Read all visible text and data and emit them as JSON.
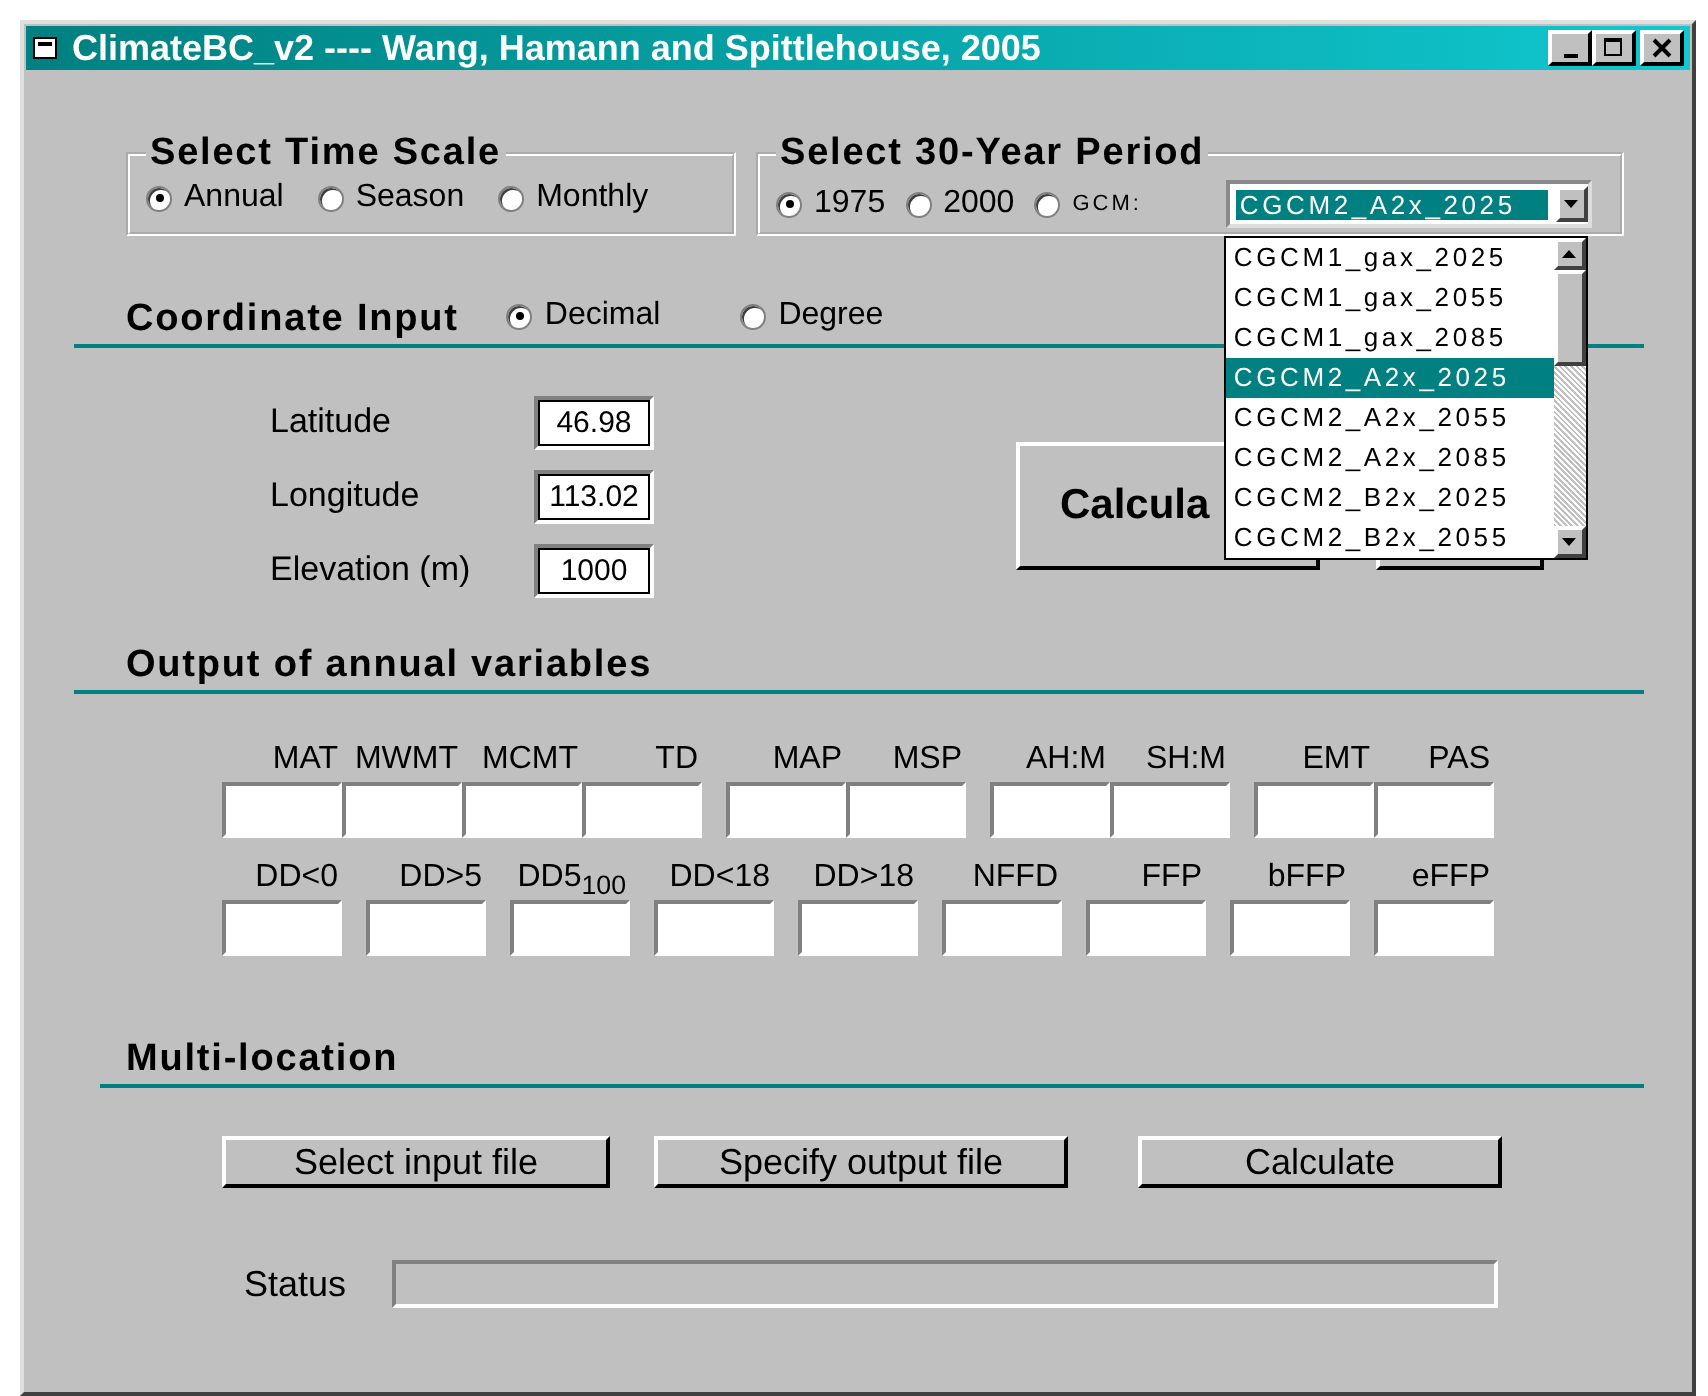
{
  "window": {
    "title": "ClimateBC_v2 ---- Wang, Hamann and Spittlehouse, 2005"
  },
  "time_scale": {
    "title": "Select Time Scale",
    "options": [
      {
        "label": "Annual",
        "selected": true
      },
      {
        "label": "Season",
        "selected": false
      },
      {
        "label": "Monthly",
        "selected": false
      }
    ]
  },
  "period": {
    "title": "Select 30-Year Period",
    "options": [
      {
        "label": "1975",
        "selected": true
      },
      {
        "label": "2000",
        "selected": false
      },
      {
        "label": "GCM:",
        "selected": false
      }
    ],
    "gcm_value": "CGCM2_A2x_2025",
    "gcm_list": [
      {
        "label": "CGCM1_gax_2025",
        "selected": false
      },
      {
        "label": "CGCM1_gax_2055",
        "selected": false
      },
      {
        "label": "CGCM1_gax_2085",
        "selected": false
      },
      {
        "label": "CGCM2_A2x_2025",
        "selected": true
      },
      {
        "label": "CGCM2_A2x_2055",
        "selected": false
      },
      {
        "label": "CGCM2_A2x_2085",
        "selected": false
      },
      {
        "label": "CGCM2_B2x_2025",
        "selected": false
      },
      {
        "label": "CGCM2_B2x_2055",
        "selected": false
      }
    ]
  },
  "coordinate_input": {
    "title": "Coordinate Input",
    "formats": [
      {
        "label": "Decimal",
        "selected": true
      },
      {
        "label": "Degree",
        "selected": false
      }
    ],
    "fields": [
      {
        "label": "Latitude",
        "value": "46.98"
      },
      {
        "label": "Longitude",
        "value": "113.02"
      },
      {
        "label": "Elevation (m)",
        "value": "1000"
      }
    ],
    "calculate_button": "Calcula"
  },
  "annual_output": {
    "title": "Output of annual variables",
    "upper_variables": [
      "MAT",
      "MWMT",
      "MCMT",
      "TD",
      "MAP",
      "MSP",
      "AH:M",
      "SH:M",
      "EMT",
      "PAS"
    ],
    "lower_variables": [
      "DD<0",
      "DD>5",
      "DD5$_{100}$",
      "DD<18",
      "DD>18",
      "NFFD",
      "FFP",
      "bFFP",
      "eFFP"
    ]
  },
  "multi_location": {
    "title": "Multi-location",
    "buttons": [
      "Select input file",
      "Specify output file",
      "Calculate"
    ],
    "status_label": "Status"
  }
}
